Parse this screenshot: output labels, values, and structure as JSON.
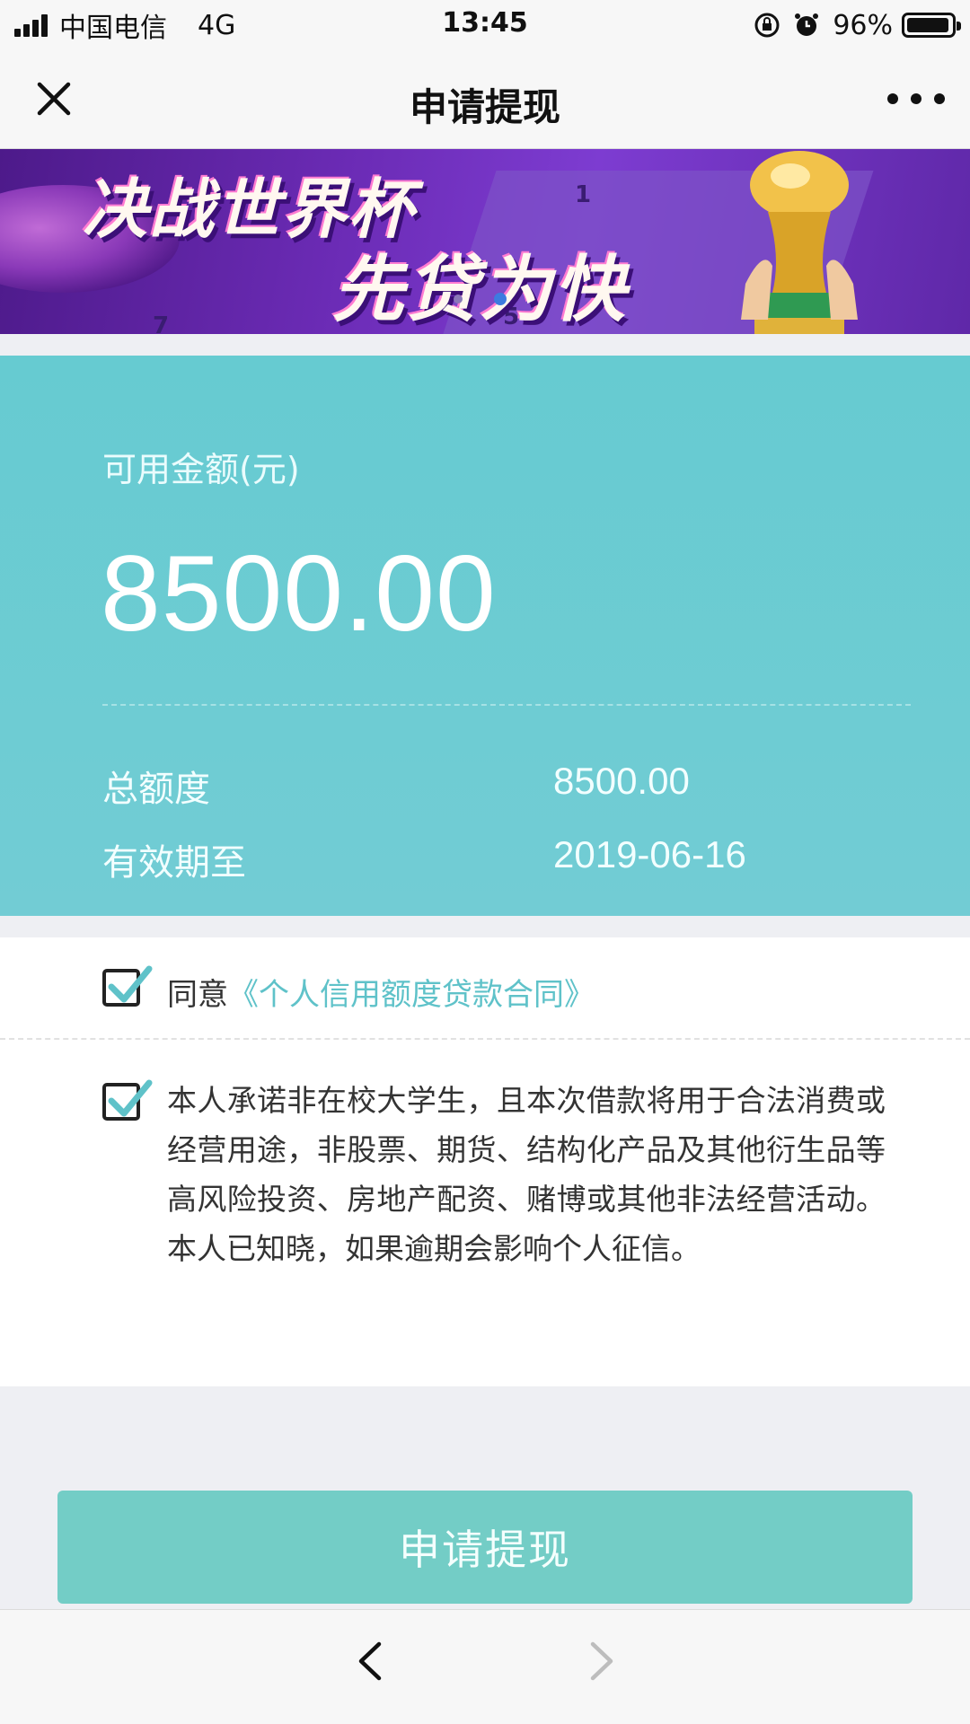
{
  "status_bar": {
    "carrier": "中国电信",
    "network": "4G",
    "time": "13:45",
    "battery": "96%",
    "battery_level": 0.96,
    "icons": [
      "signal-icon",
      "rotation-lock-icon",
      "alarm-icon",
      "battery-icon"
    ]
  },
  "nav": {
    "title": "申请提现",
    "close_icon": "close-icon",
    "more_icon": "more-icon"
  },
  "banner": {
    "line1": "决战世界杯",
    "line2": "先贷为快",
    "numbers": [
      "1",
      "5",
      "7"
    ],
    "colors": {
      "bg": "#6b2bb5",
      "accent": "#ff7bd1"
    }
  },
  "balance": {
    "label": "可用金额(元)",
    "amount": "8500.00",
    "total_label": "总额度",
    "total_value": "8500.00",
    "expire_label": "有效期至",
    "expire_value": "2019-06-16",
    "color": "#6ccbd2"
  },
  "agreements": {
    "agree1_prefix": "同意",
    "agree1_link": "《个人信用额度贷款合同》",
    "agree1_checked": true,
    "agree2_text": "本人承诺非在校大学生，且本次借款将用于合法消费或经营用途，非股票、期货、结构化产品及其他衍生品等高风险投资、房地产配资、赌博或其他非法经营活动。本人已知晓，如果逾期会影响个人征信。",
    "agree2_checked": true,
    "check_color": "#5fc2c9"
  },
  "submit": {
    "label": "申请提现",
    "color": "#73cdc6"
  },
  "bottom_bar": {
    "back_icon": "chevron-left-icon",
    "forward_icon": "chevron-right-icon"
  }
}
